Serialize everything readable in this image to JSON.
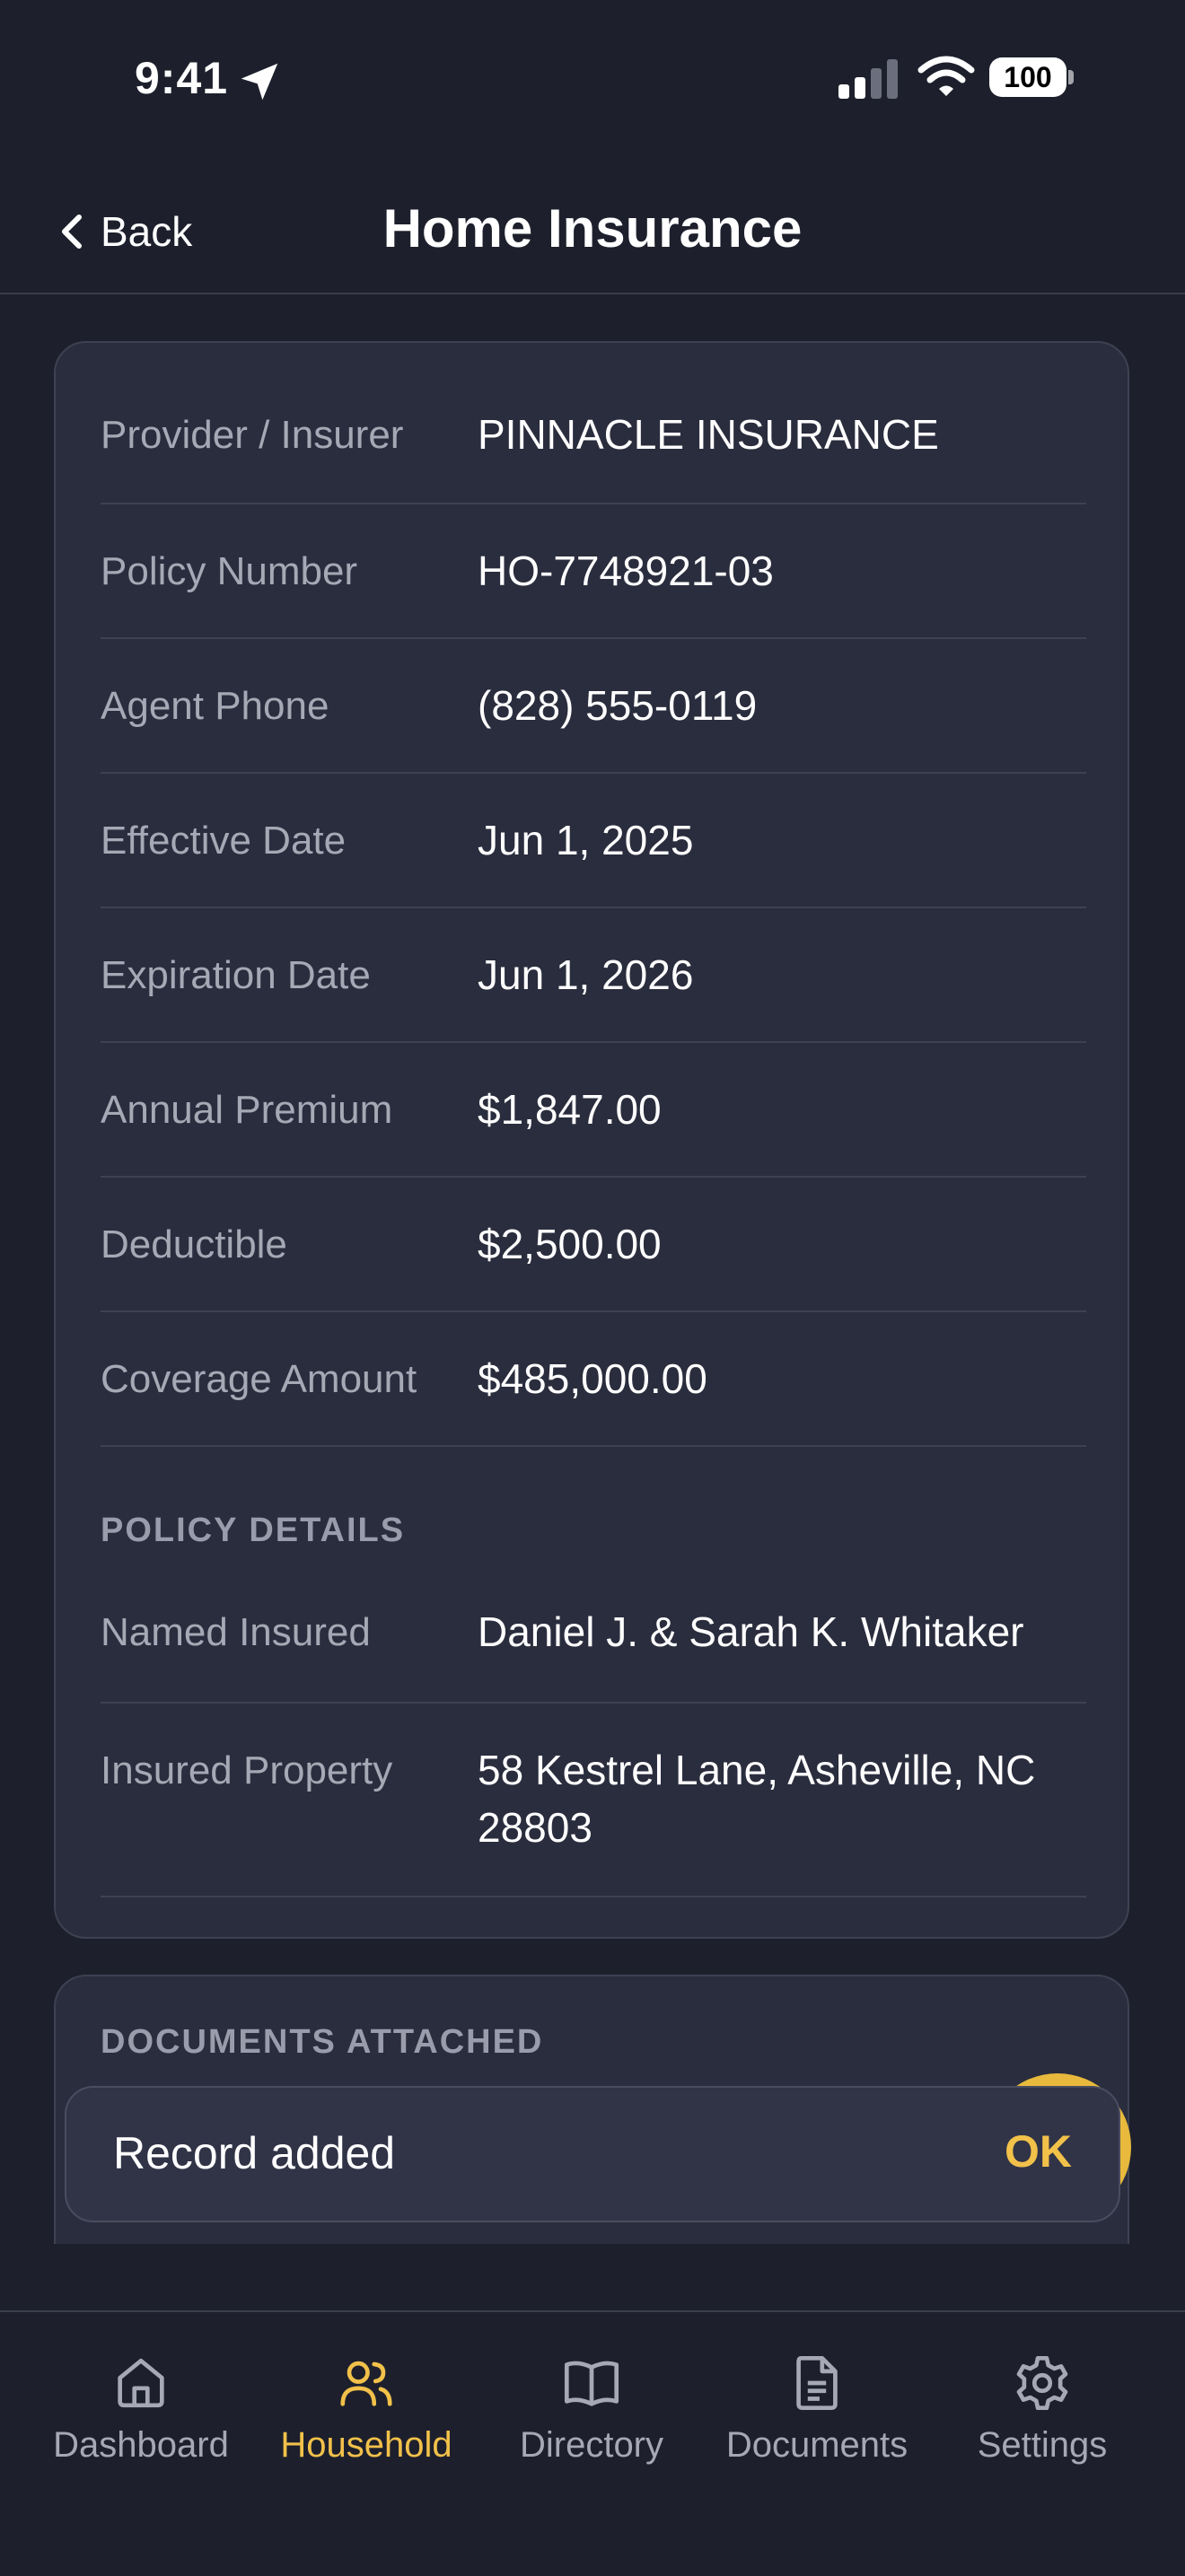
{
  "status_bar": {
    "time": "9:41",
    "battery": "100"
  },
  "header": {
    "back_label": "Back",
    "title": "Home Insurance"
  },
  "fields": [
    {
      "label": "Provider / Insurer",
      "value": "PINNACLE INSURANCE"
    },
    {
      "label": "Policy Number",
      "value": "HO-7748921-03"
    },
    {
      "label": "Agent Phone",
      "value": "(828) 555-0119"
    },
    {
      "label": "Effective Date",
      "value": "Jun 1, 2025"
    },
    {
      "label": "Expiration Date",
      "value": "Jun 1, 2026"
    },
    {
      "label": "Annual Premium",
      "value": "$1,847.00"
    },
    {
      "label": "Deductible",
      "value": "$2,500.00"
    },
    {
      "label": "Coverage Amount",
      "value": "$485,000.00"
    }
  ],
  "policy_details": {
    "header": "POLICY DETAILS",
    "fields": [
      {
        "label": "Named Insured",
        "value": "Daniel J. & Sarah K. Whitaker"
      },
      {
        "label": "Insured Property",
        "value": "58 Kestrel Lane, Asheville, NC 28803"
      }
    ]
  },
  "documents": {
    "header": "DOCUMENTS ATTACHED"
  },
  "toast": {
    "message": "Record added",
    "action": "OK"
  },
  "tabs": [
    {
      "label": "Dashboard",
      "icon": "home-icon",
      "active": false
    },
    {
      "label": "Household",
      "icon": "users-icon",
      "active": true
    },
    {
      "label": "Directory",
      "icon": "book-icon",
      "active": false
    },
    {
      "label": "Documents",
      "icon": "document-icon",
      "active": false
    },
    {
      "label": "Settings",
      "icon": "gear-icon",
      "active": false
    }
  ],
  "colors": {
    "accent": "#f2c14a",
    "background": "#1d202c",
    "card": "#2a2d3d",
    "fab": "#e8b93c"
  }
}
